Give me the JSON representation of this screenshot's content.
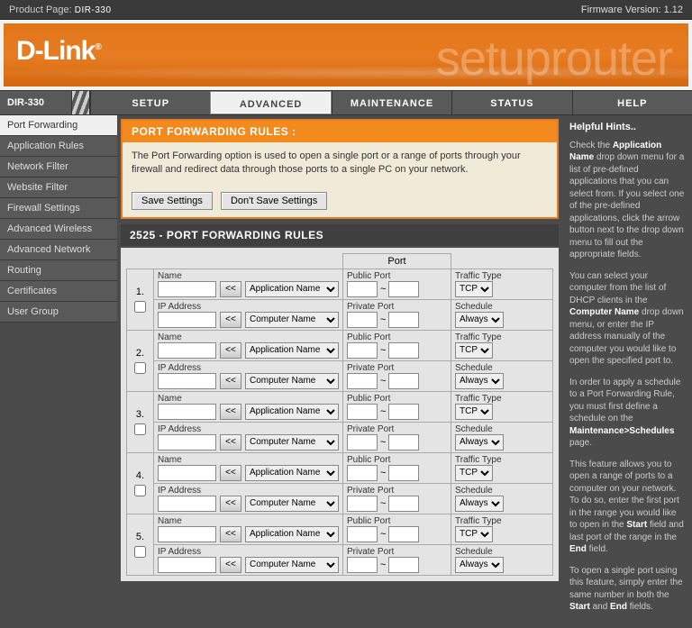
{
  "top": {
    "product_label": "Product Page:",
    "model": "DIR-330",
    "fw_label": "Firmware Version:",
    "fw_value": "1.12"
  },
  "banner": {
    "brand": "D-Link",
    "ghost": "setuprouter"
  },
  "tabs": {
    "model": "DIR-330",
    "items": [
      "SETUP",
      "ADVANCED",
      "MAINTENANCE",
      "STATUS",
      "HELP"
    ],
    "active": 1
  },
  "sidebar": {
    "items": [
      "Port Forwarding",
      "Application Rules",
      "Network Filter",
      "Website Filter",
      "Firewall Settings",
      "Advanced Wireless",
      "Advanced Network",
      "Routing",
      "Certificates",
      "User Group"
    ],
    "active": 0
  },
  "panel": {
    "title": "PORT FORWARDING RULES :",
    "desc": "The Port Forwarding option is used to open a single port or a range of ports through your firewall and redirect data through those ports to a single PC on your network.",
    "save": "Save Settings",
    "dont": "Don't Save Settings"
  },
  "rules": {
    "header": "2525 - PORT FORWARDING RULES",
    "port_col": "Port",
    "count": 5,
    "labels": {
      "name": "Name",
      "ip": "IP Address",
      "public": "Public Port",
      "private": "Private Port",
      "traffic": "Traffic Type",
      "schedule": "Schedule",
      "arrow": "<<",
      "app": "Application Name",
      "comp": "Computer Name",
      "tcp": "TCP",
      "always": "Always"
    }
  },
  "hints": {
    "title": "Helpful Hints..",
    "p1": {
      "a": "Check the ",
      "b1": "Application Name",
      "b": " drop down menu for a list of pre-defined applications that you can select from. If you select one of the pre-defined applications, click the arrow button next to the drop down menu to fill out the appropriate fields."
    },
    "p2": {
      "a": "You can select your computer from the list of DHCP clients in the ",
      "b1": "Computer Name",
      "b": " drop down menu, or enter the IP address manually of the computer you would like to open the specified port to."
    },
    "p3": {
      "a": "In order to apply a schedule to a Port Forwarding Rule, you must first define a schedule on the ",
      "b1": "Maintenance>Schedules",
      "b": " page."
    },
    "p4": {
      "a": "This feature allows you to open a range of ports to a computer on your network. To do so, enter the first port in the range you would like to open in the ",
      "b1": "Start",
      "b": " field and last port of the range in the ",
      "b2": "End",
      "c": " field."
    },
    "p5": {
      "a": "To open a single port using this feature, simply enter the same number in both the ",
      "b1": "Start",
      "b": " and ",
      "b2": "End",
      "c": " fields."
    }
  }
}
